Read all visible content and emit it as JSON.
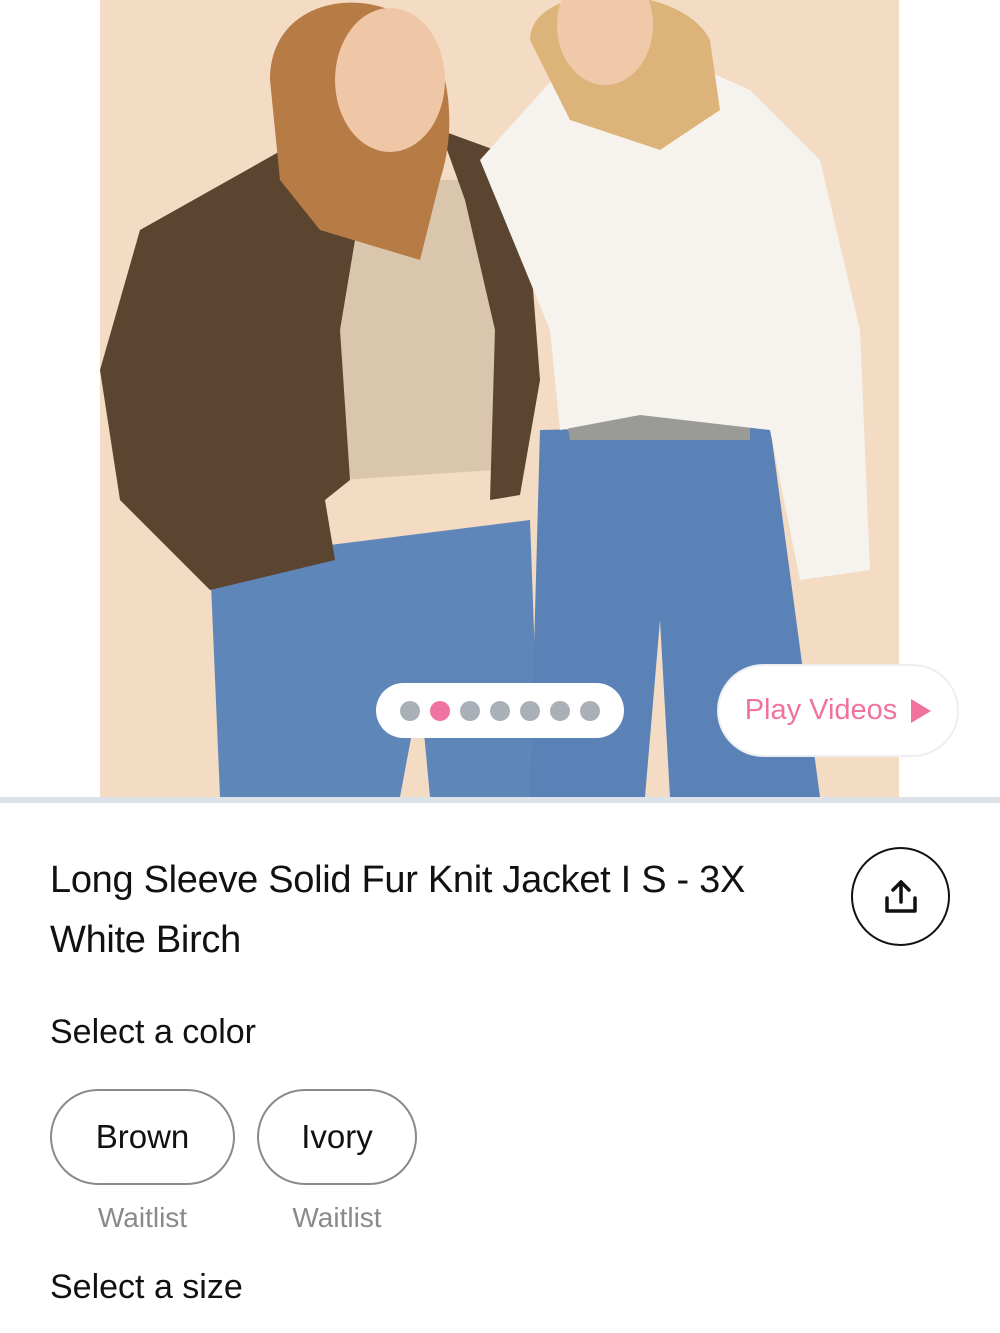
{
  "gallery": {
    "slide_count": 7,
    "active_index": 1,
    "play_videos_label": "Play Videos"
  },
  "product": {
    "title_line1": "Long Sleeve Solid Fur Knit Jacket I S - 3X",
    "title_line2": "White Birch"
  },
  "colors": {
    "section_label": "Select a color",
    "options": [
      {
        "label": "Brown",
        "status": "Waitlist"
      },
      {
        "label": "Ivory",
        "status": "Waitlist"
      }
    ]
  },
  "size": {
    "section_label": "Select a size"
  },
  "theme": {
    "accent": "#f0739f",
    "dot_inactive": "#a9b0b8",
    "photo_background": "#f3dcc3"
  },
  "icons": [
    "share-icon",
    "play-icon"
  ]
}
